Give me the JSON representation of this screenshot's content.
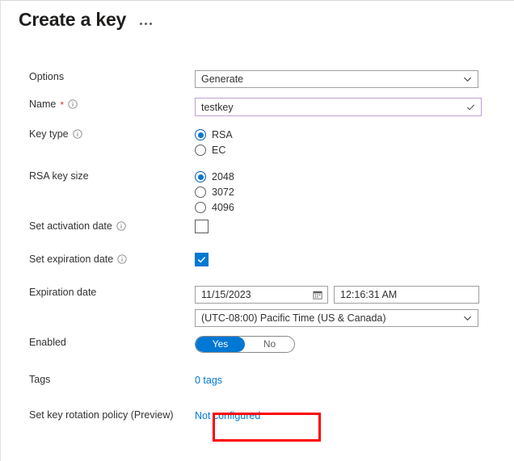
{
  "header": {
    "title": "Create a key",
    "more_menu": "···"
  },
  "form": {
    "options": {
      "label": "Options",
      "value": "Generate"
    },
    "name": {
      "label": "Name",
      "required_marker": "*",
      "value": "testkey",
      "placeholder": ""
    },
    "key_type": {
      "label": "Key type",
      "selected": "RSA",
      "choices": [
        "RSA",
        "EC"
      ]
    },
    "rsa_key_size": {
      "label": "RSA key size",
      "selected": "2048",
      "choices": [
        "2048",
        "3072",
        "4096"
      ]
    },
    "set_activation_date": {
      "label": "Set activation date",
      "checked": false
    },
    "set_expiration_date": {
      "label": "Set expiration date",
      "checked": true
    },
    "expiration_date": {
      "label": "Expiration date",
      "date_value": "11/15/2023",
      "time_value": "12:16:31 AM",
      "timezone_value": "(UTC-08:00) Pacific Time (US & Canada)"
    },
    "enabled": {
      "label": "Enabled",
      "yes_label": "Yes",
      "no_label": "No",
      "selected": "Yes"
    },
    "tags": {
      "label": "Tags",
      "value": "0 tags"
    },
    "rotation_policy": {
      "label": "Set key rotation policy (Preview)",
      "value": "Not configured"
    }
  },
  "colors": {
    "accent": "#0078d4",
    "link": "#0078d4",
    "required": "#d13438",
    "annotation": "#ff0000",
    "name_field_border": "#c09fd6"
  }
}
